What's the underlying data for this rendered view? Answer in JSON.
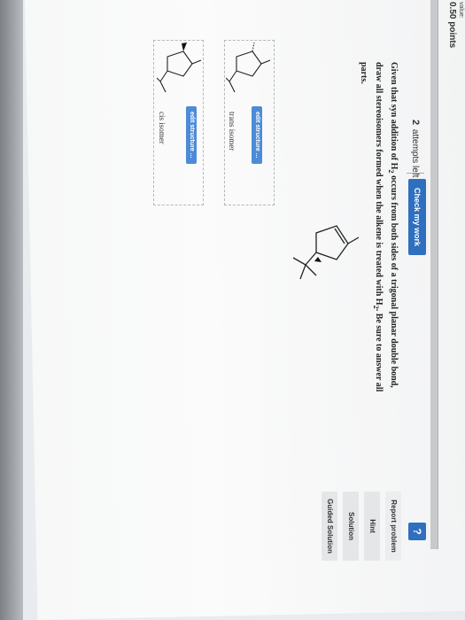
{
  "value_label": "value:",
  "points": "0.50 points",
  "attempts": {
    "count": "2",
    "label": "attempts left"
  },
  "check_button": "Check my work",
  "help_button": "?",
  "question": {
    "part1": "Given that syn addition of H",
    "sub1": "2",
    "part2": " occurs from both sides of a trigonal planar double bond, draw all stereoisomers formed when the alkene is treated with H",
    "sub2": "2",
    "part3": ". Be sure to answer all parts."
  },
  "side_links": [
    "Report problem",
    "Hint",
    "Solution",
    "Guided Solution"
  ],
  "answers": [
    {
      "edit_label": "edit structure ...",
      "isomer_label": "trans isomer"
    },
    {
      "edit_label": "edit structure ...",
      "isomer_label": "cis isomer"
    }
  ],
  "colors": {
    "accent": "#2f6fbf",
    "edit_button": "#4d8bd6"
  },
  "icons": [
    "help-icon",
    "alkene-structure",
    "cyclopentane-structure"
  ]
}
